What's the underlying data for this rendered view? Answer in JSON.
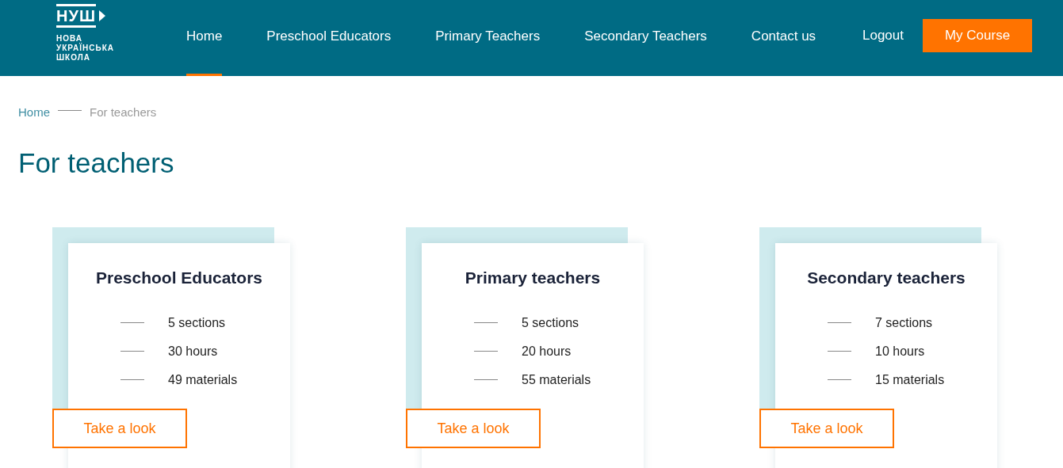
{
  "logo": {
    "mark": "НУШ",
    "lines": [
      "НОВА",
      "УКРАЇНСЬКА",
      "ШКОЛА"
    ]
  },
  "nav": [
    {
      "label": "Home",
      "selected": true
    },
    {
      "label": "Preschool Educators",
      "selected": false
    },
    {
      "label": "Primary Teachers",
      "selected": false
    },
    {
      "label": "Secondary Teachers",
      "selected": false
    },
    {
      "label": "Contact us",
      "selected": false
    }
  ],
  "logout": "Logout",
  "my_course": "My Course",
  "breadcrumb": [
    "Home",
    "For teachers"
  ],
  "heading": "For teachers",
  "cards": [
    {
      "title": "Preschool Educators",
      "stats": [
        "5 sections",
        "30 hours",
        "49 materials"
      ],
      "button": "Take a look"
    },
    {
      "title": "Primary teachers",
      "stats": [
        "5 sections",
        "20 hours",
        "55 materials"
      ],
      "button": "Take a look"
    },
    {
      "title": "Secondary teachers",
      "stats": [
        "7 sections",
        "10 hours",
        "15 materials"
      ],
      "button": "Take a look"
    }
  ]
}
